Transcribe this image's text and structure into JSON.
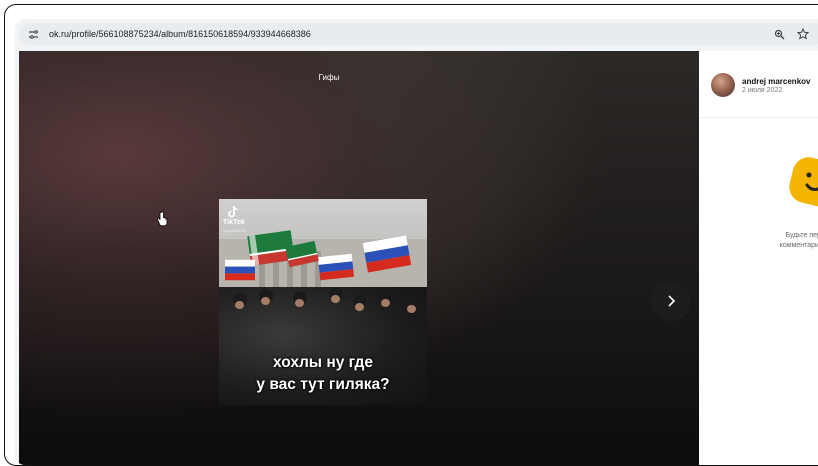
{
  "browser": {
    "url": "ok.ru/profile/566108875234/album/816150618594/933944668386"
  },
  "viewer": {
    "album_title": "Гифы",
    "gif": {
      "watermark_brand": "TikTok",
      "watermark_handle": "@user98234",
      "caption_line1": "хохлы ну где",
      "caption_line2": "у вас тут гиляка?"
    }
  },
  "sidebar": {
    "author_name": "andrej marcenkov",
    "post_date": "2 июля 2022",
    "empty_comments_line1": "Будьте первым",
    "empty_comments_line2": "комментарий к это"
  },
  "icons": {
    "site_info": "site-info-icon",
    "zoom": "zoom-icon",
    "bookmark": "star-icon",
    "next": "chevron-right-icon"
  },
  "colors": {
    "viewer_bg": "#1c1a19",
    "emoji": "#f5b400"
  }
}
